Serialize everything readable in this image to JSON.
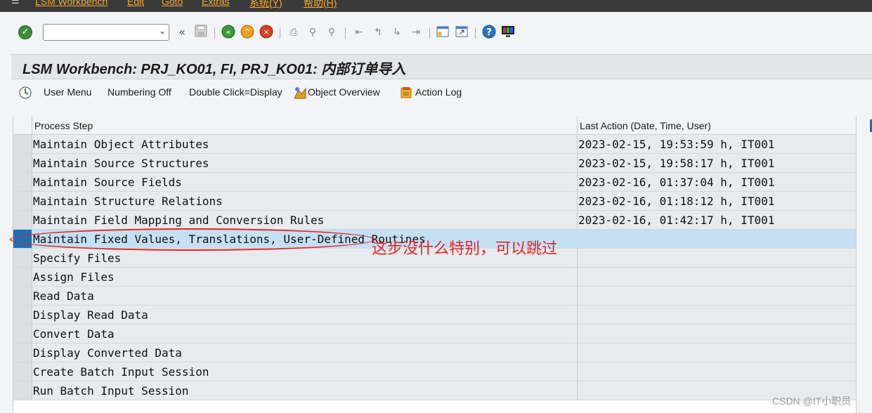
{
  "menubar": {
    "items": [
      "LSM Workbench",
      "Edit",
      "Goto",
      "Extras",
      "系统(Y)",
      "帮助(H)"
    ]
  },
  "toolbar": {
    "command_value": "",
    "icons": [
      "enter-icon",
      "back-icon",
      "save-icon",
      "green-back-icon",
      "exit-icon",
      "cancel-icon",
      "print-icon",
      "find-icon",
      "find-next-icon",
      "first-page-icon",
      "prev-page-icon",
      "next-page-icon",
      "last-page-icon",
      "create-session-icon",
      "shortcut-icon",
      "help-icon",
      "layout-menu-icon"
    ]
  },
  "title": "LSM Workbench: PRJ_KO01, FI, PRJ_KO01: 内部订单导入",
  "app_toolbar": {
    "user_menu": "User Menu",
    "numbering_off": "Numbering Off",
    "double_click": "Double Click=Display",
    "object_overview": "Object Overview",
    "action_log": "Action Log"
  },
  "grid": {
    "columns": [
      "Process Step",
      "Last Action (Date, Time, User)"
    ],
    "rows": [
      {
        "step": "Maintain Object Attributes",
        "last_action": "2023-02-15, 19:53:59 h, IT001"
      },
      {
        "step": "Maintain Source Structures",
        "last_action": "2023-02-15, 19:58:17 h, IT001"
      },
      {
        "step": "Maintain Source Fields",
        "last_action": "2023-02-16, 01:37:04 h, IT001"
      },
      {
        "step": "Maintain Structure Relations",
        "last_action": "2023-02-16, 01:18:12 h, IT001"
      },
      {
        "step": "Maintain Field Mapping and Conversion Rules",
        "last_action": "2023-02-16, 01:42:17 h, IT001"
      },
      {
        "step": "Maintain Fixed Values, Translations, User-Defined Routines",
        "last_action": ""
      },
      {
        "step": "Specify Files",
        "last_action": ""
      },
      {
        "step": "Assign Files",
        "last_action": ""
      },
      {
        "step": "Read Data",
        "last_action": ""
      },
      {
        "step": "Display Read Data",
        "last_action": ""
      },
      {
        "step": "Convert Data",
        "last_action": ""
      },
      {
        "step": "Display Converted Data",
        "last_action": ""
      },
      {
        "step": "Create Batch Input Session",
        "last_action": ""
      },
      {
        "step": "Run Batch Input Session",
        "last_action": ""
      }
    ]
  },
  "annotation": {
    "text": "这步没什么特别，可以跳过",
    "color": "#e8231f"
  },
  "watermark": "CSDN @IT小职员",
  "colors": {
    "selected_row": "#c5e0f5",
    "selected_marker": "#1e6fb5",
    "menu_text": "#f0a830"
  }
}
